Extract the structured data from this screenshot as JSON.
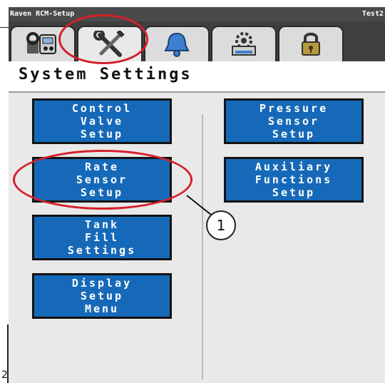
{
  "titlebar": {
    "app_name": "Raven RCM-Setup",
    "identifier": "Test2"
  },
  "tabs": [
    {
      "icon": "tools-dashboard-icon"
    },
    {
      "icon": "wrench-screwdriver-icon",
      "active": true
    },
    {
      "icon": "bell-icon"
    },
    {
      "icon": "tank-gear-icon"
    },
    {
      "icon": "lock-icon"
    }
  ],
  "header": {
    "title": "System Settings"
  },
  "buttons": {
    "control_valve": [
      "Control",
      "Valve",
      "Setup"
    ],
    "rate_sensor": [
      "Rate",
      "Sensor",
      "Setup"
    ],
    "tank_fill": [
      "Tank",
      "Fill",
      "Settings"
    ],
    "display_setup": [
      "Display",
      "Setup",
      "Menu"
    ],
    "pressure_sensor": [
      "Pressure",
      "Sensor",
      "Setup"
    ],
    "aux_functions": [
      "Auxiliary",
      "Functions",
      "Setup"
    ]
  },
  "callout": {
    "number": "1"
  },
  "page_number": "2",
  "colors": {
    "button_blue": "#1669b8",
    "highlight_red": "#d4202a",
    "titlebar": "#4a4a4a"
  }
}
